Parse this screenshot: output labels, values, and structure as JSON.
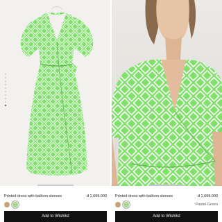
{
  "products": [
    {
      "name": "Printed dress with balloon sleeves",
      "price": "đ 1.699.000",
      "color_label": "",
      "swatches": [
        {
          "name": "tan",
          "color": "#c9a27c"
        },
        {
          "name": "green",
          "color": "#a8d98a",
          "active": true
        }
      ],
      "cta": "Add to Wishlist",
      "gallery": {
        "count": 10,
        "active_index": 9
      }
    },
    {
      "name": "Printed dress with balloon sleeves",
      "price": "đ 1.699.000",
      "color_label": "Pastel Green",
      "swatches": [
        {
          "name": "tan",
          "color": "#c9a27c"
        },
        {
          "name": "green",
          "color": "#a8d98a",
          "active": true
        }
      ],
      "cta": "Add to Wishlist",
      "back_icon": "‹"
    }
  ],
  "colors": {
    "dress_green": "#7fe06a",
    "pattern_white": "#ffffff",
    "cta_background": "#111111"
  }
}
